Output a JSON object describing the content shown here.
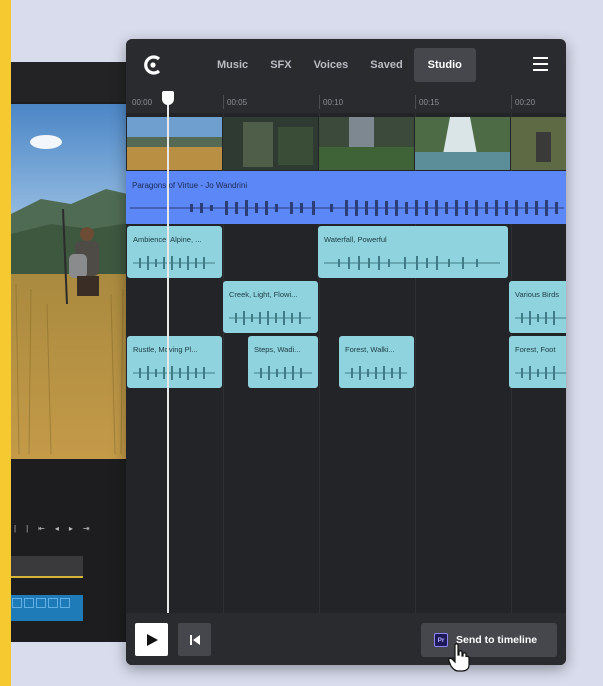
{
  "nav": {
    "tabs": [
      {
        "label": "Music",
        "active": false
      },
      {
        "label": "SFX",
        "active": false
      },
      {
        "label": "Voices",
        "active": false
      },
      {
        "label": "Saved",
        "active": false
      },
      {
        "label": "Studio",
        "active": true
      }
    ]
  },
  "ruler": {
    "ticks": [
      "00:00",
      "00:05",
      "00:10",
      "00:15",
      "00:20"
    ]
  },
  "music_track": {
    "title": "Paragons of Virtue - Jo Wandrini",
    "color": "#5b87f7"
  },
  "sfx_clips": [
    {
      "label": "Ambience, Alpine, ..."
    },
    {
      "label": "Waterfall, Powerful"
    },
    {
      "label": "Creek, Light, Flowi..."
    },
    {
      "label": "Various Birds"
    },
    {
      "label": "Rustle, Moving Pl..."
    },
    {
      "label": "Steps, Wadi..."
    },
    {
      "label": "Forest, Walki..."
    },
    {
      "label": "Forest, Foot"
    }
  ],
  "clip_color": "#8fd3de",
  "bottom": {
    "play_icon": "play-icon",
    "back_icon": "skip-back-icon",
    "premiere_badge": "Pr",
    "send_label": "Send to timeline"
  },
  "colors": {
    "accent_yellow": "#f6c931",
    "panel_bg": "#2a2b2e"
  }
}
